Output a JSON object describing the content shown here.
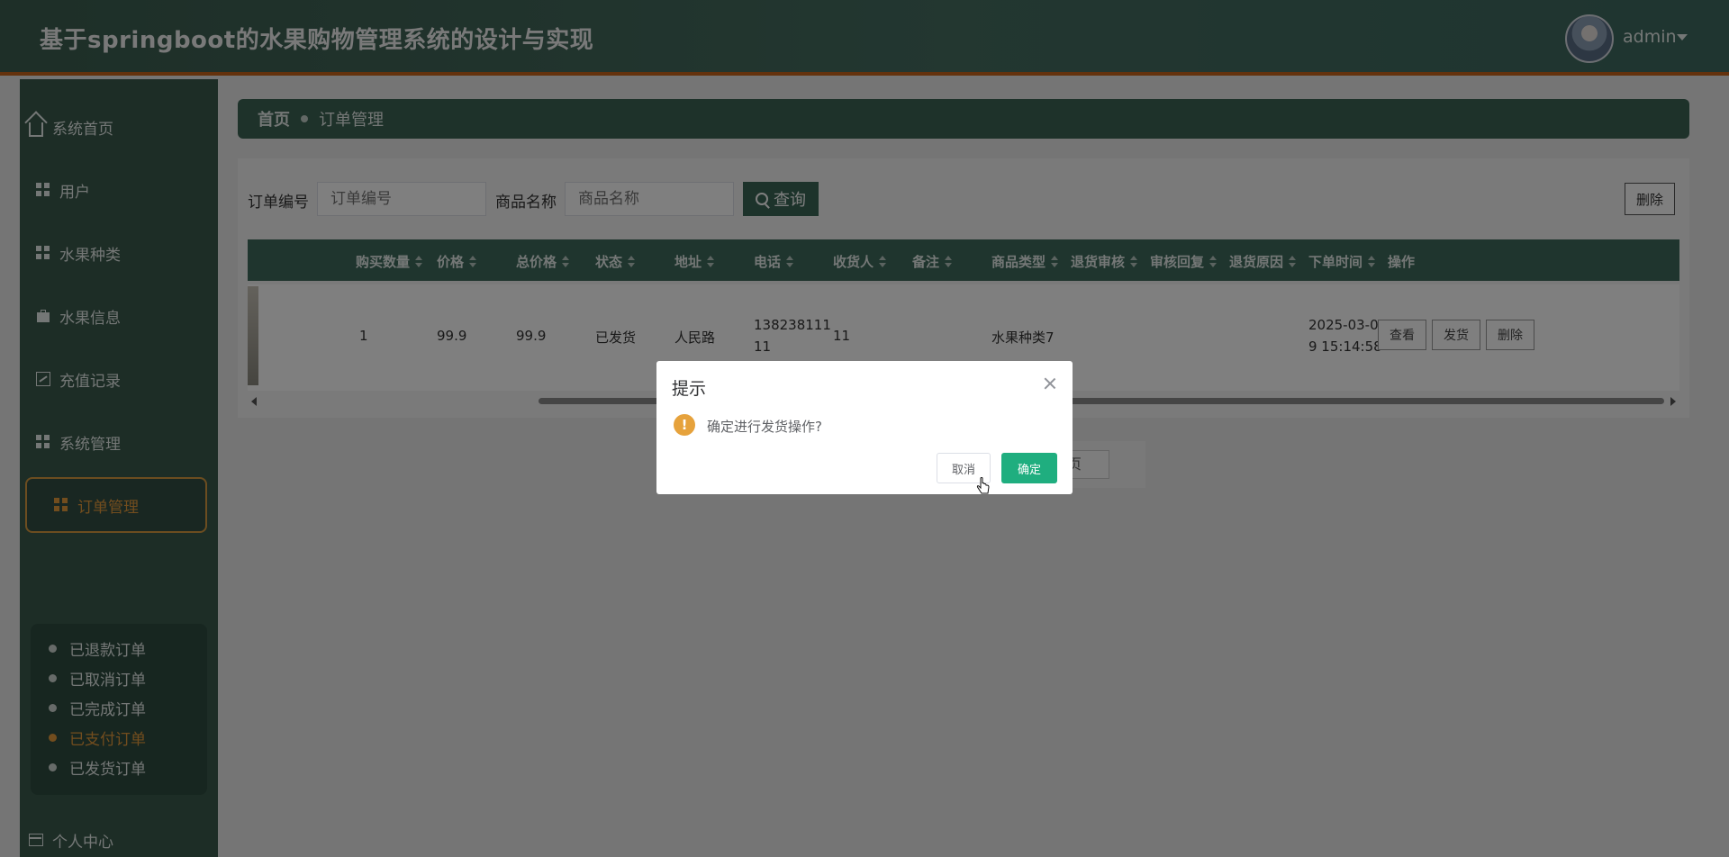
{
  "header": {
    "title": "基于springboot的水果购物管理系统的设计与实现",
    "user": "admin"
  },
  "sidebar": {
    "items": [
      {
        "label": "系统首页",
        "icon": "home-icon"
      },
      {
        "label": "用户",
        "icon": "grid-icon"
      },
      {
        "label": "水果种类",
        "icon": "grid-icon"
      },
      {
        "label": "水果信息",
        "icon": "briefcase-icon"
      },
      {
        "label": "充值记录",
        "icon": "chart-icon"
      },
      {
        "label": "系统管理",
        "icon": "grid-icon"
      },
      {
        "label": "订单管理",
        "icon": "grid-icon"
      },
      {
        "label": "个人中心",
        "icon": "card-icon"
      }
    ],
    "submenu": [
      "已退款订单",
      "已取消订单",
      "已完成订单",
      "已支付订单",
      "已发货订单"
    ]
  },
  "breadcrumb": {
    "home": "首页",
    "current": "订单管理"
  },
  "search": {
    "order_no_label": "订单编号",
    "order_no_placeholder": "订单编号",
    "product_label": "商品名称",
    "product_placeholder": "商品名称",
    "query_button": "查询",
    "delete_button": "删除"
  },
  "table": {
    "columns": [
      "购买数量",
      "价格",
      "总价格",
      "状态",
      "地址",
      "电话",
      "收货人",
      "备注",
      "商品类型",
      "退货审核",
      "审核回复",
      "退货原因",
      "下单时间",
      "操作"
    ],
    "rows": [
      {
        "qty": "1",
        "price": "99.9",
        "total": "99.9",
        "status": "已发货",
        "address": "人民路",
        "phone_line1": "138238111",
        "phone_line2": "11",
        "receiver": "11",
        "remark": "",
        "type": "水果种类7",
        "time_line1": "2025-03-0",
        "time_line2": "9 15:14:58",
        "actions": [
          "查看",
          "发货",
          "删除"
        ]
      }
    ]
  },
  "pagination": {
    "page_suffix": "页"
  },
  "dialog": {
    "title": "提示",
    "message": "确定进行发货操作?",
    "cancel": "取消",
    "confirm": "确定",
    "icon": "warning-icon"
  },
  "colors": {
    "header": "#466e61",
    "sidebar": "#3a5a4d",
    "accent": "#e59a3d",
    "confirm": "#1fae7f",
    "warning": "#e6a23c"
  }
}
